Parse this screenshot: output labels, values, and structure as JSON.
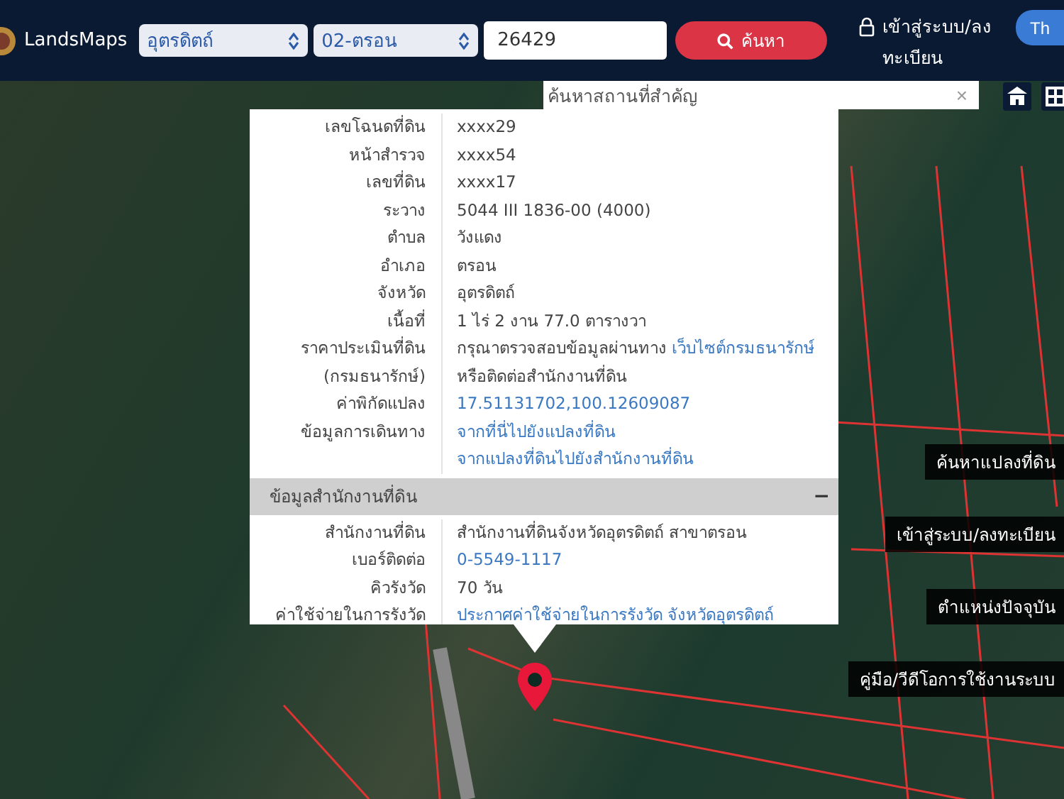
{
  "header": {
    "logo_text": "LandsMaps",
    "province": "อุตรดิตถ์",
    "district": "02-ตรอน",
    "parcel_number": "26429",
    "search_button": "ค้นหา",
    "login_link": "เข้าสู่ระบบ/ลงทะเบียน",
    "language_button": "Th"
  },
  "place_search": {
    "placeholder": "ค้นหาสถานที่สำคัญ",
    "clear": "×"
  },
  "parcel_info": {
    "rows": [
      {
        "label": "เลขโฉนดที่ดิน",
        "lines": [
          [
            {
              "text": "xxxx29",
              "kind": "text"
            }
          ]
        ]
      },
      {
        "label": "หน้าสำรวจ",
        "lines": [
          [
            {
              "text": "xxxx54",
              "kind": "text"
            }
          ]
        ]
      },
      {
        "label": "เลขที่ดิน",
        "lines": [
          [
            {
              "text": "xxxx17",
              "kind": "text"
            }
          ]
        ]
      },
      {
        "label": "ระวาง",
        "lines": [
          [
            {
              "text": "5044 III 1836-00 (4000)",
              "kind": "text"
            }
          ]
        ]
      },
      {
        "label": "ตำบล",
        "lines": [
          [
            {
              "text": "วังแดง",
              "kind": "text"
            }
          ]
        ]
      },
      {
        "label": "อำเภอ",
        "lines": [
          [
            {
              "text": "ตรอน",
              "kind": "text"
            }
          ]
        ]
      },
      {
        "label": "จังหวัด",
        "lines": [
          [
            {
              "text": "อุตรดิตถ์",
              "kind": "text"
            }
          ]
        ]
      },
      {
        "label": "เนื้อที่",
        "lines": [
          [
            {
              "text": "1 ไร่ 2 งาน 77.0 ตารางวา",
              "kind": "text"
            }
          ]
        ]
      },
      {
        "label": "ราคาประเมินที่ดิน",
        "lines": [
          [
            {
              "text": "กรุณาตรวจสอบข้อมูลผ่านทาง ",
              "kind": "text"
            },
            {
              "text": "เว็บไซต์กรมธนารักษ์",
              "kind": "link"
            }
          ]
        ]
      },
      {
        "label": "(กรมธนารักษ์)",
        "lines": [
          [
            {
              "text": "หรือติดต่อสำนักงานที่ดิน",
              "kind": "text"
            }
          ]
        ]
      },
      {
        "label": "ค่าพิกัดแปลง",
        "lines": [
          [
            {
              "text": "17.51131702,100.12609087",
              "kind": "link"
            }
          ]
        ]
      },
      {
        "label": "ข้อมูลการเดินทาง",
        "lines": [
          [
            {
              "text": "จากที่นี่ไปยังแปลงที่ดิน",
              "kind": "link"
            }
          ],
          [
            {
              "text": "จากแปลงที่ดินไปยังสำนักงานที่ดิน",
              "kind": "link"
            }
          ]
        ]
      }
    ]
  },
  "office_section": {
    "title": "ข้อมูลสำนักงานที่ดิน",
    "toggle": "−",
    "rows": [
      {
        "label": "สำนักงานที่ดิน",
        "lines": [
          [
            {
              "text": "สำนักงานที่ดินจังหวัดอุตรดิตถ์ สาขาตรอน",
              "kind": "text"
            }
          ]
        ]
      },
      {
        "label": "เบอร์ติดต่อ",
        "lines": [
          [
            {
              "text": "0-5549-1117",
              "kind": "link"
            }
          ]
        ]
      },
      {
        "label": "คิวรังวัด",
        "lines": [
          [
            {
              "text": "70 วัน",
              "kind": "text"
            }
          ]
        ]
      },
      {
        "label": "ค่าใช้จ่ายในการรังวัด",
        "lines": [
          [
            {
              "text": "ประกาศค่าใช้จ่ายในการรังวัด จังหวัดอุตรดิตถ์",
              "kind": "link"
            }
          ]
        ]
      }
    ]
  },
  "side_buttons": [
    "ค้นหาแปลงที่ดิน",
    "เข้าสู่ระบบ/ลงทะเบียน",
    "ตำแหน่งปัจจุบัน",
    "คู่มือ/วีดีโอการใช้งานระบบ"
  ]
}
